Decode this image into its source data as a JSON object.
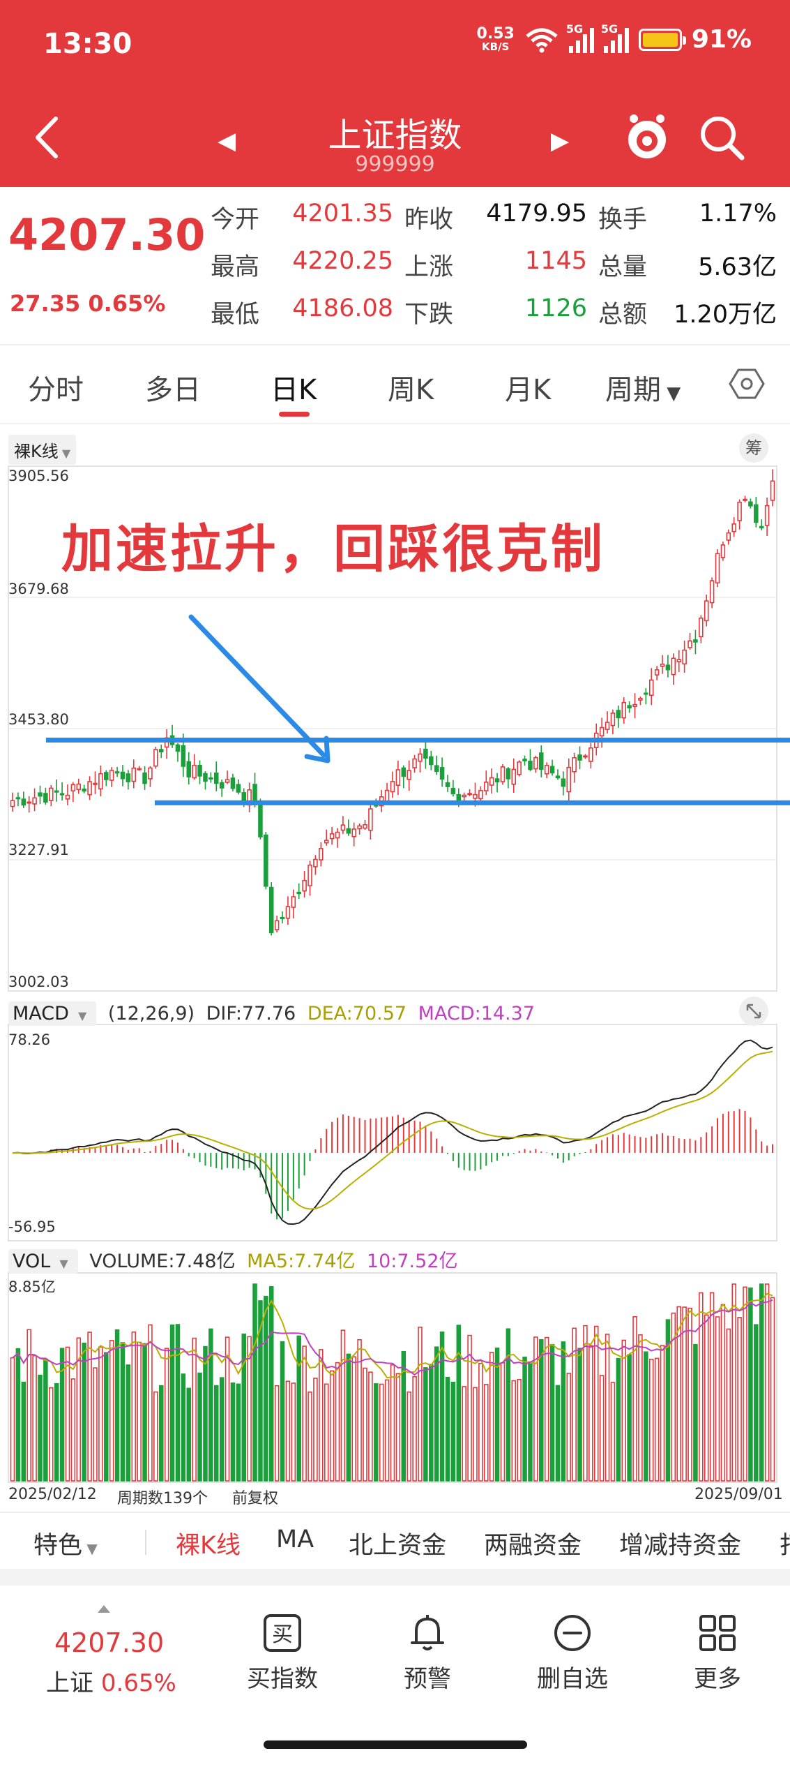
{
  "status": {
    "time": "13:30",
    "speed_value": "0.53",
    "speed_unit": "KB/S",
    "net1": "5G",
    "net2": "5G",
    "battery": "91%"
  },
  "nav": {
    "title": "上证指数",
    "code": "999999"
  },
  "quote": {
    "price": "4207.30",
    "change": "27.35",
    "change_pct": "0.65%",
    "rows": [
      [
        {
          "label": "今开",
          "value": "4201.35",
          "color": "red"
        },
        {
          "label": "昨收",
          "value": "4179.95",
          "color": "black"
        },
        {
          "label": "换手",
          "value": "1.17%",
          "color": "black"
        }
      ],
      [
        {
          "label": "最高",
          "value": "4220.25",
          "color": "red"
        },
        {
          "label": "上涨",
          "value": "1145",
          "color": "red"
        },
        {
          "label": "总量",
          "value": "5.63亿",
          "color": "black"
        }
      ],
      [
        {
          "label": "最低",
          "value": "4186.08",
          "color": "red"
        },
        {
          "label": "下跌",
          "value": "1126",
          "color": "green"
        },
        {
          "label": "总额",
          "value": "1.20万亿",
          "color": "black"
        }
      ]
    ]
  },
  "tabs": {
    "items": [
      "分时",
      "多日",
      "日K",
      "周K",
      "月K",
      "周期"
    ],
    "active": "日K"
  },
  "chart": {
    "kline_label": "裸K线",
    "chou_label": "筹",
    "annotation": "加速拉升，回踩很克制",
    "macd_label": "MACD",
    "macd_params": "(12,26,9)",
    "dif_text": "DIF:77.76",
    "dea_text": "DEA:70.57",
    "macd_text": "MACD:14.37",
    "macd_top": "78.26",
    "macd_bottom": "-56.95",
    "vol_label": "VOL",
    "volume_text": "VOLUME:7.48亿",
    "ma5_text": "MA5:7.74亿",
    "ma10_text": "10:7.52亿",
    "vol_top": "8.85亿",
    "start_date": "2025/02/12",
    "period_count": "周期数139个",
    "adjust": "前复权",
    "end_date": "2025/09/01",
    "colors": {
      "up": "#e4393c",
      "down": "#1aa03a",
      "line": "#2a8ae6",
      "dea": "#b8b000",
      "ma10": "#c23ec2"
    }
  },
  "chart_data": {
    "type": "candlestick",
    "title": "上证指数",
    "x_start": "2025/02/12",
    "x_end": "2025/09/01",
    "count": 139,
    "price_ticks": [
      "3905.56",
      "3679.68",
      "3453.80",
      "3227.91",
      "3002.03"
    ],
    "ylim": [
      3002.03,
      3905.56
    ],
    "close_anchors": [
      [
        0,
        3330
      ],
      [
        10,
        3345
      ],
      [
        18,
        3380
      ],
      [
        24,
        3370
      ],
      [
        28,
        3440
      ],
      [
        32,
        3380
      ],
      [
        40,
        3355
      ],
      [
        44,
        3330
      ],
      [
        47,
        3110
      ],
      [
        50,
        3140
      ],
      [
        56,
        3260
      ],
      [
        64,
        3290
      ],
      [
        69,
        3370
      ],
      [
        74,
        3400
      ],
      [
        80,
        3340
      ],
      [
        85,
        3350
      ],
      [
        93,
        3400
      ],
      [
        100,
        3365
      ],
      [
        104,
        3420
      ],
      [
        110,
        3480
      ],
      [
        118,
        3555
      ],
      [
        124,
        3615
      ],
      [
        129,
        3780
      ],
      [
        133,
        3860
      ],
      [
        136,
        3800
      ],
      [
        138,
        3880
      ]
    ],
    "horizontal_lines": [
      3434,
      3326
    ],
    "macd": {
      "top": 78.26,
      "bottom": -56.95,
      "last_dif": 77.76,
      "last_dea": 70.57,
      "last_macd": 14.37
    },
    "volume": {
      "max": "8.85亿",
      "last": "7.48亿",
      "ma5": "7.74亿",
      "ma10": "7.52亿"
    }
  },
  "subtabs": {
    "items": [
      "特色",
      "裸K线",
      "MA",
      "北上资金",
      "两融资金",
      "增减持资金",
      "打"
    ],
    "active": "裸K线"
  },
  "bottom": {
    "price": "4207.30",
    "name": "上证",
    "pct": "0.65%",
    "items": [
      {
        "label": "买指数",
        "icon": "buy-icon"
      },
      {
        "label": "预警",
        "icon": "bell-icon"
      },
      {
        "label": "删自选",
        "icon": "remove-icon"
      },
      {
        "label": "更多",
        "icon": "grid-icon"
      }
    ],
    "buy_glyph": "买"
  }
}
